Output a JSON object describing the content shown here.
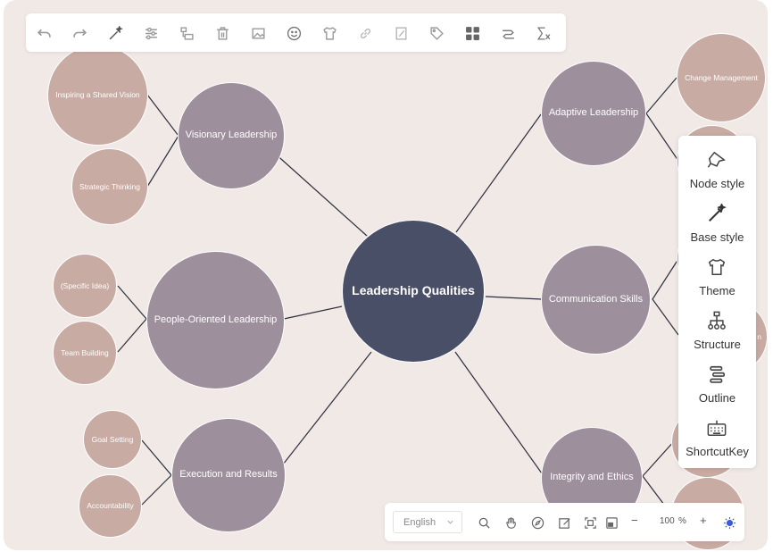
{
  "mindmap": {
    "root": "Leadership Qualities",
    "branches": [
      {
        "label": "Visionary Leadership",
        "children": [
          "Inspiring a Shared Vision",
          "Strategic Thinking"
        ]
      },
      {
        "label": "People-Oriented Leadership",
        "children": [
          "(Specific Idea)",
          "Team Building"
        ]
      },
      {
        "label": "Execution and Results",
        "children": [
          "Goal Setting",
          "Accountability"
        ]
      },
      {
        "label": "Adaptive Leadership",
        "children": [
          "Change Management",
          ""
        ]
      },
      {
        "label": "Communication Skills",
        "children": [
          "",
          "n"
        ]
      },
      {
        "label": "Integrity and Ethics",
        "children": [
          "",
          ""
        ]
      }
    ]
  },
  "toolbar": {
    "icons": [
      "undo-icon",
      "redo-icon",
      "format-painter-icon",
      "style-settings-icon",
      "structure-icon",
      "delete-icon",
      "image-icon",
      "emoji-icon",
      "theme-shirt-icon",
      "link-icon",
      "note-icon",
      "tag-icon",
      "summary-grid-icon",
      "association-icon",
      "formula-icon"
    ]
  },
  "side_panel": {
    "items": [
      {
        "label": "Node style",
        "icon": "pin-icon"
      },
      {
        "label": "Base style",
        "icon": "magic-wand-icon"
      },
      {
        "label": "Theme",
        "icon": "shirt-icon"
      },
      {
        "label": "Structure",
        "icon": "hierarchy-icon"
      },
      {
        "label": "Outline",
        "icon": "outline-icon"
      },
      {
        "label": "ShortcutKey",
        "icon": "keyboard-icon"
      }
    ]
  },
  "bottom_bar": {
    "language": "English",
    "zoom_value": "100",
    "zoom_unit": "%",
    "zoom_out": "−",
    "zoom_in": "+"
  },
  "colors": {
    "canvas": "#f1e9e6",
    "root_node": "#4a4f68",
    "main_node": "#9d8f9c",
    "leaf_node": "#c8aba3",
    "accent": "#3b5bdb"
  }
}
